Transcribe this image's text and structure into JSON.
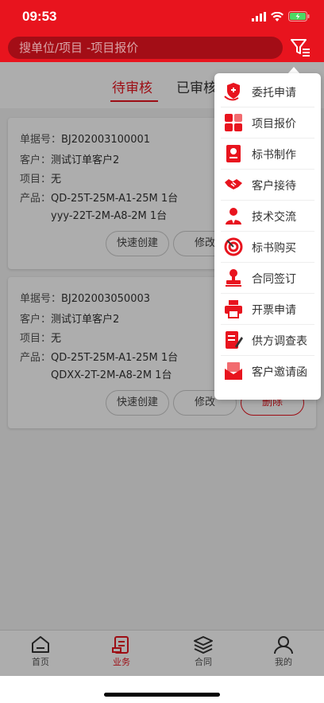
{
  "status": {
    "time": "09:53"
  },
  "search": {
    "placeholder": "搜单位/项目 -项目报价"
  },
  "tabs": {
    "pending": "待审核",
    "reviewed": "已审核"
  },
  "orders": [
    {
      "number_label": "单据号：",
      "number": "BJ202003100001",
      "customer_label": "客户：",
      "customer": "测试订单客户2",
      "project_label": "项目：",
      "project": "无",
      "product_label": "产品：",
      "products": [
        "QD-25T-25M-A1-25M 1台",
        "yyy-22T-2M-A8-2M 1台"
      ],
      "buttons": {
        "quick_create": "快速创建",
        "edit": "修改"
      }
    },
    {
      "number_label": "单据号：",
      "number": "BJ202003050003",
      "customer_label": "客户：",
      "customer": "测试订单客户2",
      "project_label": "项目：",
      "project": "无",
      "product_label": "产品：",
      "products": [
        "QD-25T-25M-A1-25M 1台",
        "QDXX-2T-2M-A8-2M 1台"
      ],
      "buttons": {
        "quick_create": "快速创建",
        "edit": "修改",
        "delete": "删除"
      }
    }
  ],
  "menu": {
    "items": [
      {
        "label": "委托申请",
        "icon": "shield-hand-icon"
      },
      {
        "label": "项目报价",
        "icon": "grid-icon"
      },
      {
        "label": "标书制作",
        "icon": "document-badge-icon"
      },
      {
        "label": "客户接待",
        "icon": "handshake-icon"
      },
      {
        "label": "技术交流",
        "icon": "person-icon"
      },
      {
        "label": "标书购买",
        "icon": "target-icon"
      },
      {
        "label": "合同签订",
        "icon": "stamp-icon"
      },
      {
        "label": "开票申请",
        "icon": "printer-icon"
      },
      {
        "label": "供方调查表",
        "icon": "survey-icon"
      },
      {
        "label": "客户邀请函",
        "icon": "envelope-icon"
      }
    ]
  },
  "tabbar": {
    "home": "首页",
    "business": "业务",
    "contract": "合同",
    "mine": "我的"
  },
  "colors": {
    "accent": "#e8141e"
  }
}
